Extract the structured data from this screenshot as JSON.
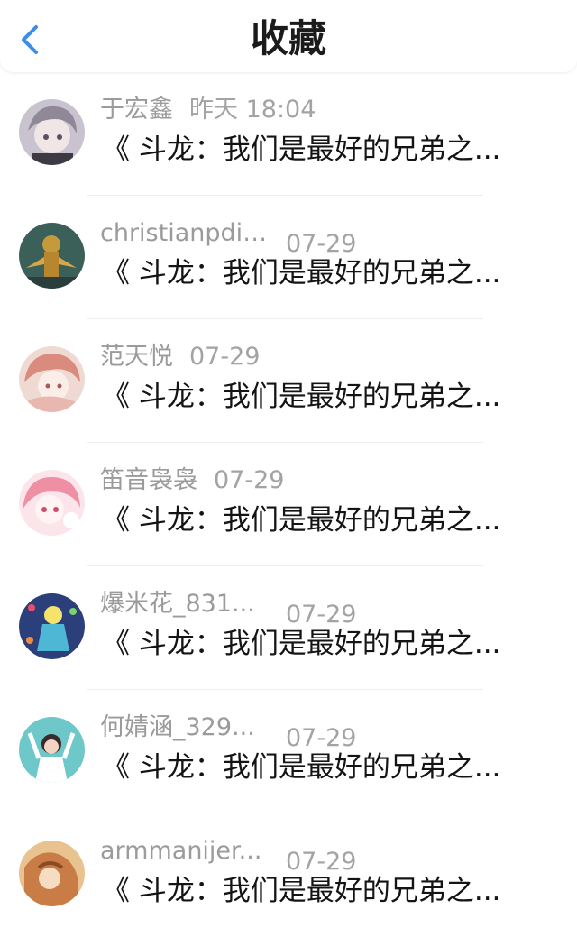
{
  "header": {
    "title": "收藏",
    "back_icon": "chevron-left-icon",
    "accent": "#3a8ee6"
  },
  "items": [
    {
      "user": "于宏鑫",
      "time": "昨天 18:04",
      "headline": "《 斗龙：我们是最好的兄弟之..."
    },
    {
      "user": "christianpdil...",
      "time": "07-29",
      "headline": "《 斗龙：我们是最好的兄弟之..."
    },
    {
      "user": "范天悦",
      "time": "07-29",
      "headline": "《 斗龙：我们是最好的兄弟之..."
    },
    {
      "user": "笛音袅袅",
      "time": "07-29",
      "headline": "《 斗龙：我们是最好的兄弟之..."
    },
    {
      "user": "爆米花_831...",
      "time": "07-29",
      "headline": "《 斗龙：我们是最好的兄弟之..."
    },
    {
      "user": "何婧涵_329...",
      "time": "07-29",
      "headline": "《 斗龙：我们是最好的兄弟之..."
    },
    {
      "user": "armmanijer...",
      "time": "07-29",
      "headline": "《 斗龙：我们是最好的兄弟之..."
    }
  ]
}
